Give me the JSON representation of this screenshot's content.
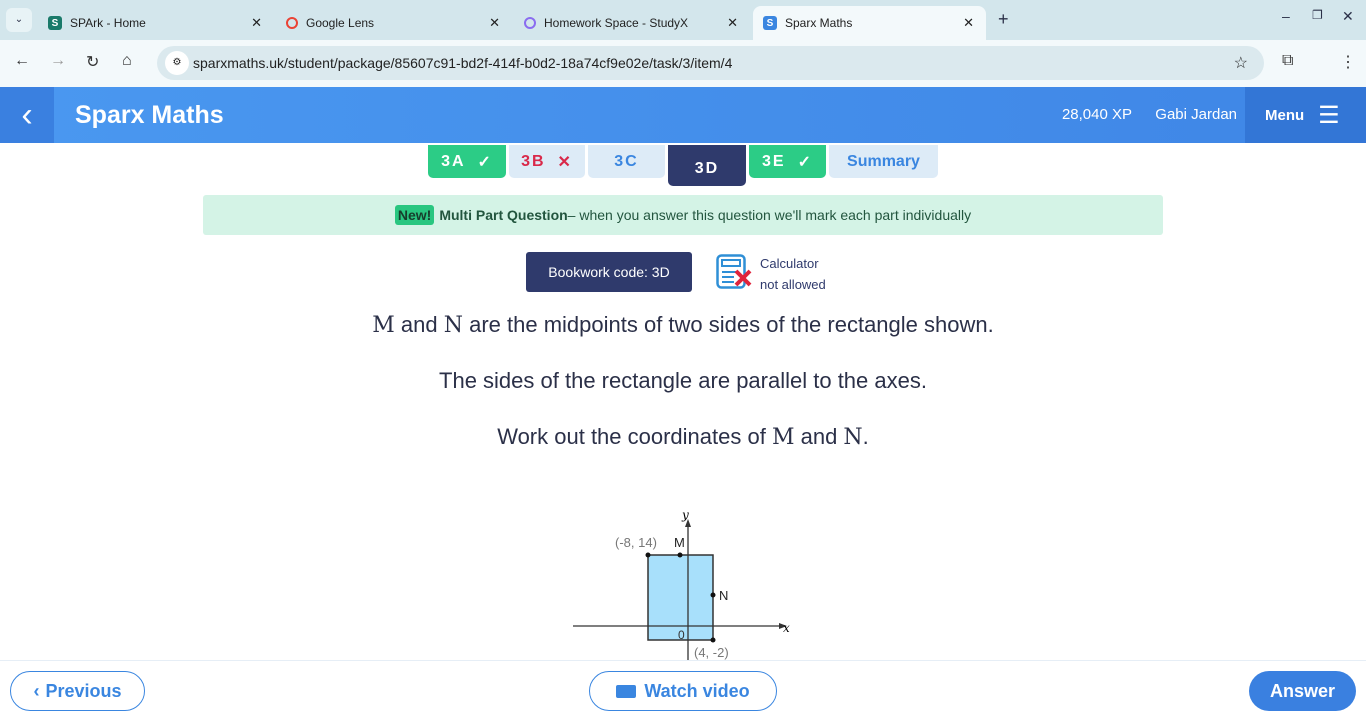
{
  "browser": {
    "tabs": [
      {
        "title": "SPArk - Home",
        "color": "#1a7a6a"
      },
      {
        "title": "Google Lens",
        "color": "#ea4335"
      },
      {
        "title": "Homework Space - StudyX",
        "color": "#8a6cf0"
      },
      {
        "title": "Sparx Maths",
        "color": "#3a86e0",
        "active": true
      }
    ],
    "url": "sparxmaths.uk/student/package/85607c91-bd2f-414f-b0d2-18a74cf9e02e/task/3/item/4"
  },
  "header": {
    "brand": "Sparx Maths",
    "xp": "28,040 XP",
    "user": "Gabi Jardan",
    "menu": "Menu"
  },
  "parts": [
    {
      "label": "3A",
      "status": "correct"
    },
    {
      "label": "3B",
      "status": "incorrect"
    },
    {
      "label": "3C",
      "status": ""
    },
    {
      "label": "3D",
      "status": "selected"
    },
    {
      "label": "3E",
      "status": "correct"
    },
    {
      "label": "Summary",
      "status": ""
    }
  ],
  "banner": {
    "badge": "New!",
    "title": "Multi Part Question",
    "text": " – when you answer this question we'll mark each part individually"
  },
  "bookwork": "Bookwork code: 3D",
  "calculator": {
    "line1": "Calculator",
    "line2": "not allowed"
  },
  "question": {
    "line1_a": "M",
    "line1_b": " and ",
    "line1_c": "N",
    "line1_d": " are the midpoints of two sides of the rectangle shown.",
    "line2": "The sides of the rectangle are parallel to the axes.",
    "line3_a": "Work out the coordinates of ",
    "line3_b": "M",
    "line3_c": " and ",
    "line3_d": "N",
    "line3_e": "."
  },
  "diagram": {
    "corner1": "(-8, 14)",
    "corner2": "(4, -2)",
    "label_m": "M",
    "label_n": "N",
    "origin": "0",
    "xaxis": "x",
    "yaxis": "y",
    "fill": "#a8e0fb"
  },
  "footer": {
    "previous": "Previous",
    "watch": "Watch video",
    "answer": "Answer"
  }
}
